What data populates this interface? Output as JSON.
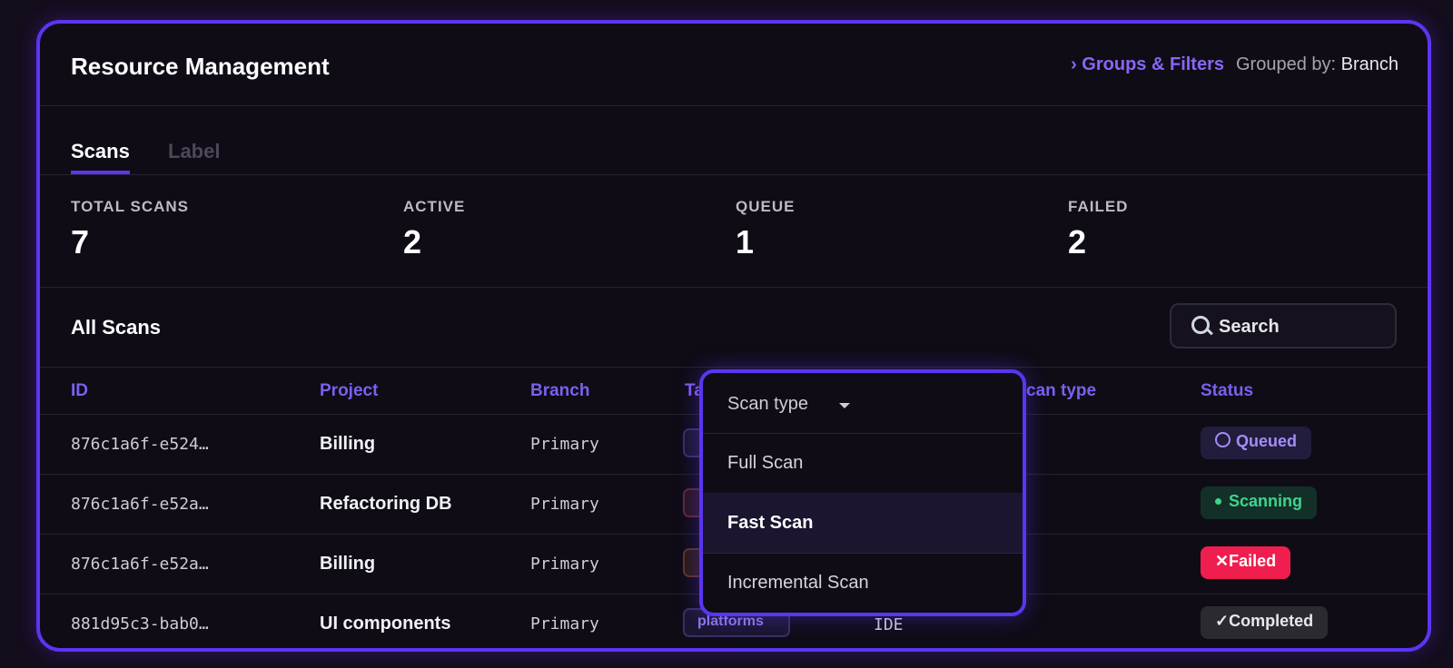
{
  "header": {
    "title": "Resource Management",
    "groups_filters": "› Groups & Filters",
    "grouped_by_label": "Grouped by:",
    "grouped_by_value": "Branch"
  },
  "tabs": [
    {
      "label": "Scans",
      "active": true
    },
    {
      "label": "Label",
      "active": false
    }
  ],
  "stats": [
    {
      "label": "TOTAL SCANS",
      "value": "7"
    },
    {
      "label": "ACTIVE",
      "value": "2"
    },
    {
      "label": "QUEUE",
      "value": "1"
    },
    {
      "label": "FAILED",
      "value": "2"
    }
  ],
  "section": {
    "title": "All Scans",
    "search_placeholder": "Search"
  },
  "table": {
    "columns": [
      "ID",
      "Project",
      "Branch",
      "Ta",
      "can type",
      "Status"
    ],
    "rows": [
      {
        "id": "876c1a6f-e524…",
        "project": "Billing",
        "branch": "Primary",
        "tag": "",
        "scan_type": "",
        "status": "Queued"
      },
      {
        "id": "876c1a6f-e52a…",
        "project": "Refactoring DB",
        "branch": "Primary",
        "tag": "",
        "scan_type": "",
        "status": "Scanning"
      },
      {
        "id": "876c1a6f-e52a…",
        "project": "Billing",
        "branch": "Primary",
        "tag": "",
        "scan_type": "",
        "status": "Failed"
      },
      {
        "id": "881d95c3-bab0…",
        "project": "UI components",
        "branch": "Primary",
        "tag": "platforms",
        "scan_type": "IDE",
        "status": "Completed"
      }
    ]
  },
  "status_icons": {
    "Queued": "○",
    "Failed": "✕",
    "Completed": "✓"
  },
  "dropdown": {
    "label": "Scan type",
    "options": [
      "Full Scan",
      "Fast Scan",
      "Incremental Scan"
    ],
    "selected": "Fast Scan"
  },
  "colors": {
    "accent": "#5b35f0",
    "queued": "#a58cf6",
    "scanning": "#3fd48e",
    "failed": "#f01e4e"
  }
}
